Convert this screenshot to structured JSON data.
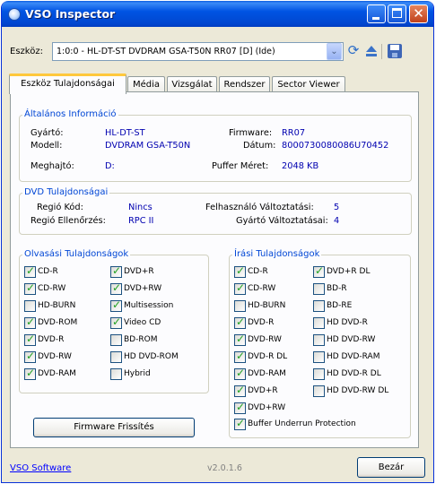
{
  "window": {
    "title": "VSO Inspector"
  },
  "toolbar": {
    "device_label": "Eszköz:",
    "device_value": "1:0:0 - HL-DT-ST DVDRAM GSA-T50N RR07 [D] (Ide)",
    "icons": [
      "dropdown-arrow-icon",
      "refresh-icon",
      "eject-icon",
      "save-icon"
    ]
  },
  "tabs": [
    {
      "label": "Eszköz Tulajdonságai",
      "active": true
    },
    {
      "label": "Média"
    },
    {
      "label": "Vizsgálat"
    },
    {
      "label": "Rendszer"
    },
    {
      "label": "Sector Viewer"
    }
  ],
  "general": {
    "title": "Általános Információ",
    "manufacturer_label": "Gyártó:",
    "manufacturer": "HL-DT-ST",
    "model_label": "Modell:",
    "model": "DVDRAM GSA-T50N",
    "drive_label": "Meghajtó:",
    "drive": "D:",
    "firmware_label": "Firmware:",
    "firmware": "RR07",
    "date_label": "Dátum:",
    "date": "8000730080086U70452",
    "buffer_label": "Puffer Méret:",
    "buffer": "2048 KB"
  },
  "dvd": {
    "title": "DVD Tulajdonságai",
    "region_label": "Regió Kód:",
    "region": "Nincs",
    "region_ctrl_label": "Regió Ellenőrzés:",
    "region_ctrl": "RPC II",
    "user_changes_label": "Felhasználó Változtatási:",
    "user_changes": "5",
    "vendor_changes_label": "Gyártó Változtatásai:",
    "vendor_changes": "4"
  },
  "read": {
    "title": "Olvasási Tulajdonságok",
    "col1": [
      {
        "label": "CD-R",
        "checked": true
      },
      {
        "label": "CD-RW",
        "checked": true
      },
      {
        "label": "HD-BURN",
        "checked": false
      },
      {
        "label": "DVD-ROM",
        "checked": true
      },
      {
        "label": "DVD-R",
        "checked": true
      },
      {
        "label": "DVD-RW",
        "checked": true
      },
      {
        "label": "DVD-RAM",
        "checked": true
      }
    ],
    "col2": [
      {
        "label": "DVD+R",
        "checked": true
      },
      {
        "label": "DVD+RW",
        "checked": true
      },
      {
        "label": "Multisession",
        "checked": true
      },
      {
        "label": "Video CD",
        "checked": true
      },
      {
        "label": "BD-ROM",
        "checked": false
      },
      {
        "label": "HD DVD-ROM",
        "checked": false
      },
      {
        "label": "Hybrid",
        "checked": false
      }
    ]
  },
  "write": {
    "title": "Írási Tulajdonságok",
    "col1": [
      {
        "label": "CD-R",
        "checked": true
      },
      {
        "label": "CD-RW",
        "checked": true
      },
      {
        "label": "HD-BURN",
        "checked": false
      },
      {
        "label": "DVD-R",
        "checked": true
      },
      {
        "label": "DVD-RW",
        "checked": true
      },
      {
        "label": "DVD-R DL",
        "checked": true
      },
      {
        "label": "DVD-RAM",
        "checked": true
      },
      {
        "label": "DVD+R",
        "checked": true
      },
      {
        "label": "DVD+RW",
        "checked": true
      }
    ],
    "col2": [
      {
        "label": "DVD+R DL",
        "checked": true
      },
      {
        "label": "BD-R",
        "checked": false
      },
      {
        "label": "BD-RE",
        "checked": false
      },
      {
        "label": "HD DVD-R",
        "checked": false
      },
      {
        "label": "HD DVD-RW",
        "checked": false
      },
      {
        "label": "HD DVD-RAM",
        "checked": false
      },
      {
        "label": "HD DVD-R DL",
        "checked": false
      },
      {
        "label": "HD DVD-RW DL",
        "checked": false
      }
    ],
    "buffer_underrun": {
      "label": "Buffer Underrun Protection",
      "checked": true
    }
  },
  "firmware_button": "Firmware Frissítés",
  "footer": {
    "link": "VSO Software",
    "version": "v2.0.1.6",
    "close_button": "Bezár"
  }
}
